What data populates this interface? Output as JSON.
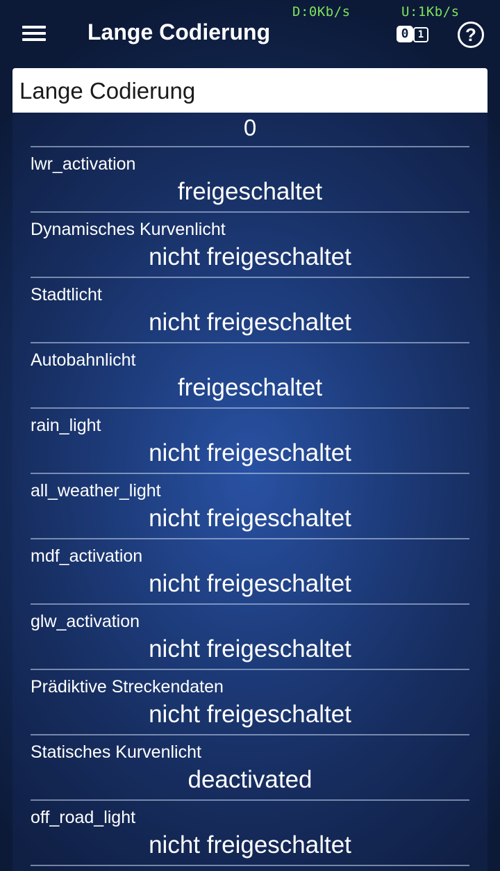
{
  "status": {
    "download": "D:0Kb/s",
    "upload": "U:1Kb/s",
    "color": "#7ee35a"
  },
  "toolbar": {
    "menu_icon": "hamburger-menu-icon",
    "title": "Lange Codierung",
    "binary_toggle": {
      "left": "0",
      "right": "1"
    },
    "help_label": "?"
  },
  "panel": {
    "header": "Lange Codierung",
    "first_value": "0",
    "rows": [
      {
        "label": "lwr_activation",
        "value": "freigeschaltet"
      },
      {
        "label": "Dynamisches Kurvenlicht",
        "value": "nicht freigeschaltet"
      },
      {
        "label": "Stadtlicht",
        "value": "nicht freigeschaltet"
      },
      {
        "label": "Autobahnlicht",
        "value": "freigeschaltet"
      },
      {
        "label": "rain_light",
        "value": "nicht freigeschaltet"
      },
      {
        "label": "all_weather_light",
        "value": "nicht freigeschaltet"
      },
      {
        "label": "mdf_activation",
        "value": "nicht freigeschaltet"
      },
      {
        "label": "glw_activation",
        "value": "nicht freigeschaltet"
      },
      {
        "label": "Prädiktive Streckendaten",
        "value": "nicht freigeschaltet"
      },
      {
        "label": "Statisches Kurvenlicht",
        "value": "deactivated"
      },
      {
        "label": "off_road_light",
        "value": "nicht freigeschaltet"
      }
    ]
  }
}
